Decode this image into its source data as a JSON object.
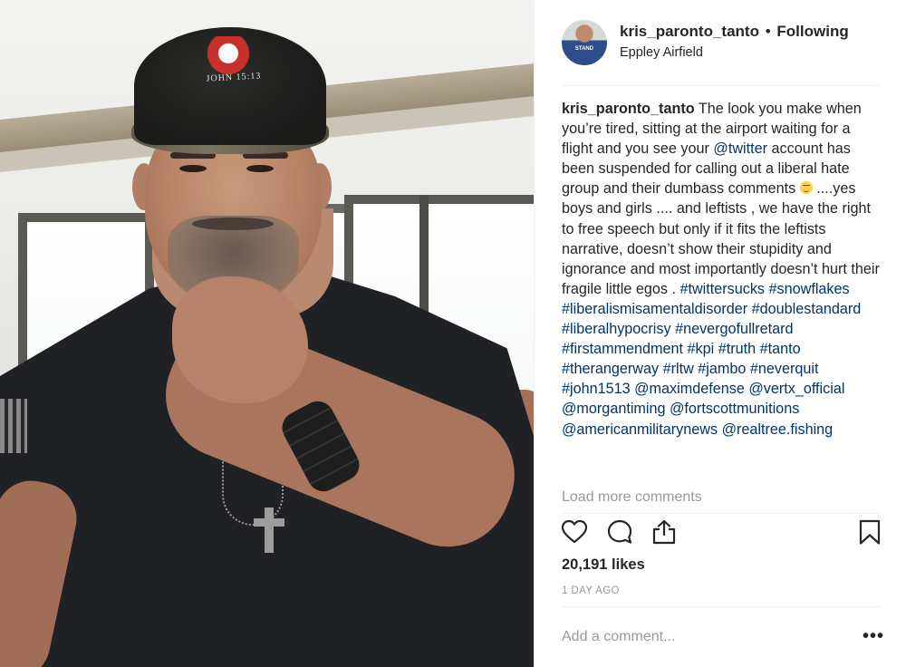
{
  "post": {
    "username": "kris_paronto_tanto",
    "separator": "•",
    "follow_state": "Following",
    "location": "Eppley Airfield",
    "photo": {
      "cap_text": "JOHN 15:13"
    },
    "avatar_text": "STAND"
  },
  "caption": {
    "username": "kris_paronto_tanto",
    "text_1": " The look you make when you’re tired, sitting at the airport waiting for a flight and you see your ",
    "mention_twitter": "@twitter",
    "text_2": " account has been suspended for calling out a liberal hate group and their dumbass comments ",
    "emoji_name": "unamused-face-emoji",
    "text_3": " ....yes boys and girls .... and leftists , we have the right to free speech but only if it fits the leftists narrative, doesn’t show their stupidity and ignorance and most importantly doesn’t hurt their fragile little egos . ",
    "tags": [
      "#twittersucks",
      "#snowflakes",
      "#liberalismisamentaldisorder",
      "#doublestandard",
      "#liberalhypocrisy",
      "#nevergofullretard",
      "#firstammendment",
      "#kpi",
      "#truth",
      "#tanto",
      "#therangerway",
      "#rltw",
      "#jambo",
      "#neverquit",
      "#john1513",
      "@maximdefense",
      "@vertx_official",
      "@morgantiming",
      "@fortscottmunitions",
      "@americanmilitarynews",
      "@realtree.fishing"
    ]
  },
  "load_more": "Load more comments",
  "actions": {
    "like_icon": "heart-icon",
    "comment_icon": "comment-bubble-icon",
    "share_icon": "share-icon",
    "save_icon": "bookmark-icon"
  },
  "likes": "20,191 likes",
  "timestamp": "1 DAY AGO",
  "comment_placeholder": "Add a comment...",
  "more_options": "•••",
  "colors": {
    "text": "#262626",
    "link": "#003569",
    "muted": "#999999",
    "divider": "#efefef"
  }
}
